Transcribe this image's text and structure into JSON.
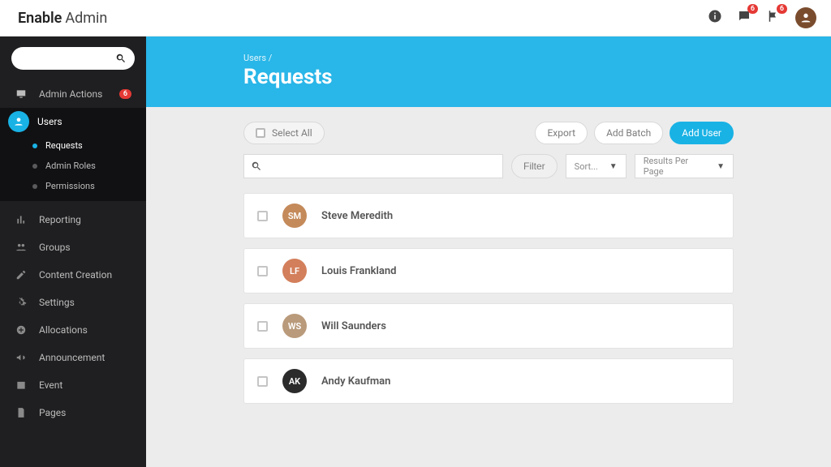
{
  "brand": {
    "word1": "Enable",
    "word2": "Admin"
  },
  "topbar": {
    "badge_chat": "6",
    "badge_flag": "6"
  },
  "sidebar": {
    "admin_actions": {
      "label": "Admin Actions",
      "count": "6"
    },
    "users": {
      "label": "Users",
      "sub": [
        {
          "label": "Requests",
          "selected": true
        },
        {
          "label": "Admin Roles",
          "selected": false
        },
        {
          "label": "Permissions",
          "selected": false
        }
      ]
    },
    "items": [
      {
        "label": "Reporting"
      },
      {
        "label": "Groups"
      },
      {
        "label": "Content Creation"
      },
      {
        "label": "Settings"
      },
      {
        "label": "Allocations"
      },
      {
        "label": "Announcement"
      },
      {
        "label": "Event"
      },
      {
        "label": "Pages"
      }
    ]
  },
  "banner": {
    "crumb": "Users /",
    "title": "Requests"
  },
  "toolbar": {
    "select_all": "Select All",
    "export": "Export",
    "add_batch": "Add Batch",
    "add_user": "Add User",
    "filter": "Filter",
    "sort": "Sort...",
    "results_per_page": "Results Per Page"
  },
  "users_list": [
    {
      "name": "Steve Meredith",
      "avatar_bg": "#c48a5a",
      "initials": "SM"
    },
    {
      "name": "Louis Frankland",
      "avatar_bg": "#d37f5b",
      "initials": "LF"
    },
    {
      "name": "Will Saunders",
      "avatar_bg": "#b99a7a",
      "initials": "WS"
    },
    {
      "name": "Andy Kaufman",
      "avatar_bg": "#2b2b2b",
      "initials": "AK"
    }
  ]
}
